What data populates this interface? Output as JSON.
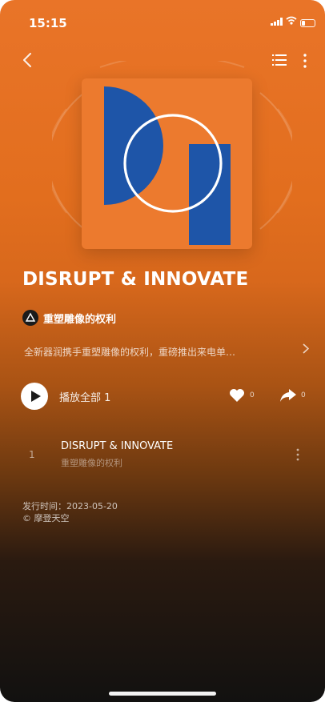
{
  "status_bar": {
    "time": "15:15"
  },
  "nav": {
    "back_icon": "chevron-left-icon",
    "list_icon": "list-icon",
    "more_icon": "more-vertical-icon"
  },
  "album": {
    "title": "DISRUPT & INNOVATE",
    "artist": "重塑雕像的权利",
    "description": "全新器润携手重塑雕像的权利，重磅推出来电单…",
    "cover_colors": {
      "background": "#ec7a2e",
      "shape": "#1e55a8",
      "ring": "#ffffff"
    }
  },
  "actions": {
    "play_all_label": "播放全部 1",
    "like_count": "0",
    "share_count": "0"
  },
  "tracks": [
    {
      "number": "1",
      "title": "DISRUPT & INNOVATE",
      "artist": "重塑雕像的权利"
    }
  ],
  "footer": {
    "release_date": "发行时间：2023-05-20",
    "copyright": "© 摩登天空"
  },
  "theme": {
    "accent": "#e97428"
  }
}
